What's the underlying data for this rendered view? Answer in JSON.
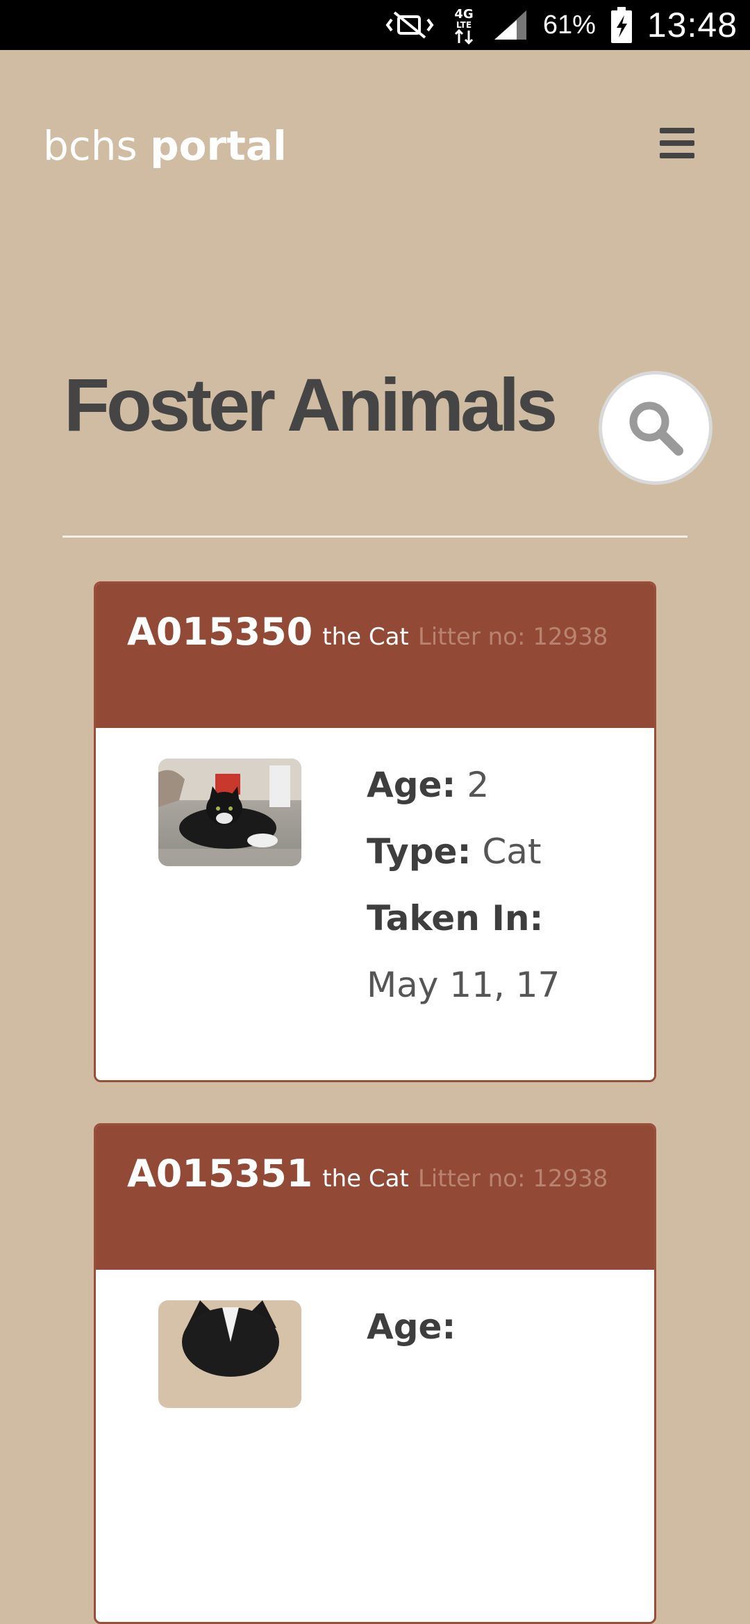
{
  "status_bar": {
    "battery": "61%",
    "time": "13:48",
    "network": "4G LTE",
    "icons": [
      "mute-vibrate-icon",
      "data-4g-icon",
      "signal-icon",
      "battery-charging-icon"
    ]
  },
  "app": {
    "logo_light": "bchs",
    "logo_bold": "portal"
  },
  "page": {
    "title": "Foster Animals"
  },
  "colors": {
    "background": "#d0bca2",
    "card_header": "#924a36",
    "title_text": "#454545"
  },
  "animals": [
    {
      "id": "A015350",
      "kind": "the Cat",
      "litter": "Litter no: 12938",
      "age_label": "Age:",
      "age": "2",
      "type_label": "Type:",
      "type": "Cat",
      "taken_label": "Taken In:",
      "taken_in": "May 11, 17"
    },
    {
      "id": "A015351",
      "kind": "the Cat",
      "litter": "Litter no: 12938",
      "age_label": "Age:"
    }
  ]
}
